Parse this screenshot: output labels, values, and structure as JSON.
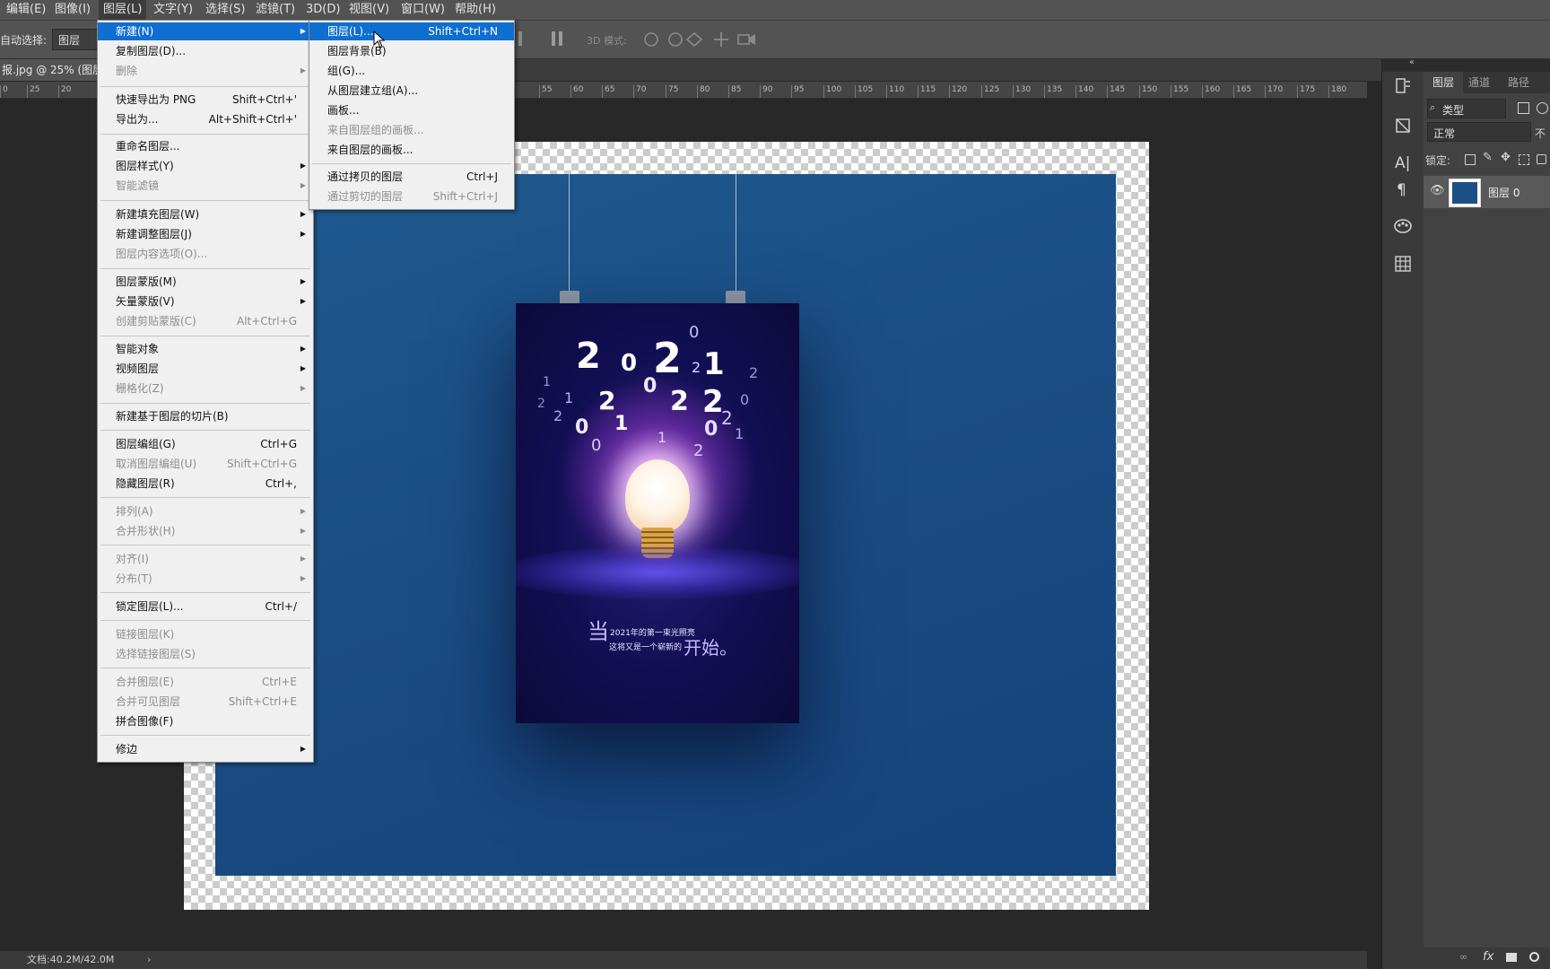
{
  "menubar": {
    "items": [
      "编辑(E)",
      "图像(I)",
      "图层(L)",
      "文字(Y)",
      "选择(S)",
      "滤镜(T)",
      "3D(D)",
      "视图(V)",
      "窗口(W)",
      "帮助(H)"
    ]
  },
  "options": {
    "auto_select_label": "自动选择:",
    "auto_select_value": "图层",
    "mode3d_label": "3D 模式:"
  },
  "doc": {
    "tab_title": "报.jpg @ 25% (图层",
    "status": "文档:40.2M/42.0M"
  },
  "ruler": {
    "ticks": [
      "0",
      "25",
      "20",
      "55",
      "60",
      "65",
      "70",
      "75",
      "80",
      "85",
      "90",
      "95",
      "100",
      "105",
      "110",
      "115",
      "120",
      "125",
      "130",
      "135",
      "140",
      "145",
      "150",
      "155",
      "160",
      "165",
      "170",
      "175",
      "180"
    ]
  },
  "layer_menu": {
    "items": [
      {
        "label": "新建(N)",
        "shortcut": "",
        "submenu": true,
        "disabled": false,
        "highlight": true
      },
      {
        "label": "复制图层(D)...",
        "shortcut": "",
        "submenu": false,
        "disabled": false
      },
      {
        "label": "删除",
        "shortcut": "",
        "submenu": true,
        "disabled": true
      },
      {
        "label": "快速导出为 PNG",
        "shortcut": "Shift+Ctrl+'",
        "submenu": false,
        "disabled": false
      },
      {
        "label": "导出为...",
        "shortcut": "Alt+Shift+Ctrl+'",
        "submenu": false,
        "disabled": false
      },
      {
        "label": "重命名图层...",
        "shortcut": "",
        "submenu": false,
        "disabled": false
      },
      {
        "label": "图层样式(Y)",
        "shortcut": "",
        "submenu": true,
        "disabled": false
      },
      {
        "label": "智能滤镜",
        "shortcut": "",
        "submenu": true,
        "disabled": true
      },
      {
        "label": "新建填充图层(W)",
        "shortcut": "",
        "submenu": true,
        "disabled": false
      },
      {
        "label": "新建调整图层(J)",
        "shortcut": "",
        "submenu": true,
        "disabled": false
      },
      {
        "label": "图层内容选项(O)...",
        "shortcut": "",
        "submenu": false,
        "disabled": true
      },
      {
        "label": "图层蒙版(M)",
        "shortcut": "",
        "submenu": true,
        "disabled": false
      },
      {
        "label": "矢量蒙版(V)",
        "shortcut": "",
        "submenu": true,
        "disabled": false
      },
      {
        "label": "创建剪贴蒙版(C)",
        "shortcut": "Alt+Ctrl+G",
        "submenu": false,
        "disabled": true
      },
      {
        "label": "智能对象",
        "shortcut": "",
        "submenu": true,
        "disabled": false
      },
      {
        "label": "视频图层",
        "shortcut": "",
        "submenu": true,
        "disabled": false
      },
      {
        "label": "栅格化(Z)",
        "shortcut": "",
        "submenu": true,
        "disabled": true
      },
      {
        "label": "新建基于图层的切片(B)",
        "shortcut": "",
        "submenu": false,
        "disabled": false
      },
      {
        "label": "图层编组(G)",
        "shortcut": "Ctrl+G",
        "submenu": false,
        "disabled": false
      },
      {
        "label": "取消图层编组(U)",
        "shortcut": "Shift+Ctrl+G",
        "submenu": false,
        "disabled": true
      },
      {
        "label": "隐藏图层(R)",
        "shortcut": "Ctrl+,",
        "submenu": false,
        "disabled": false
      },
      {
        "label": "排列(A)",
        "shortcut": "",
        "submenu": true,
        "disabled": true
      },
      {
        "label": "合并形状(H)",
        "shortcut": "",
        "submenu": true,
        "disabled": true
      },
      {
        "label": "对齐(I)",
        "shortcut": "",
        "submenu": true,
        "disabled": true
      },
      {
        "label": "分布(T)",
        "shortcut": "",
        "submenu": true,
        "disabled": true
      },
      {
        "label": "锁定图层(L)...",
        "shortcut": "Ctrl+/",
        "submenu": false,
        "disabled": false
      },
      {
        "label": "链接图层(K)",
        "shortcut": "",
        "submenu": false,
        "disabled": true
      },
      {
        "label": "选择链接图层(S)",
        "shortcut": "",
        "submenu": false,
        "disabled": true
      },
      {
        "label": "合并图层(E)",
        "shortcut": "Ctrl+E",
        "submenu": false,
        "disabled": true
      },
      {
        "label": "合并可见图层",
        "shortcut": "Shift+Ctrl+E",
        "submenu": false,
        "disabled": true
      },
      {
        "label": "拼合图像(F)",
        "shortcut": "",
        "submenu": false,
        "disabled": false
      },
      {
        "label": "修边",
        "shortcut": "",
        "submenu": true,
        "disabled": false
      }
    ]
  },
  "new_submenu": {
    "items": [
      {
        "label": "图层(L)...",
        "shortcut": "Shift+Ctrl+N",
        "disabled": false,
        "highlight": true
      },
      {
        "label": "图层背景(B)",
        "shortcut": "",
        "disabled": false
      },
      {
        "label": "组(G)...",
        "shortcut": "",
        "disabled": false
      },
      {
        "label": "从图层建立组(A)...",
        "shortcut": "",
        "disabled": false
      },
      {
        "label": "画板...",
        "shortcut": "",
        "disabled": false
      },
      {
        "label": "来自图层组的画板...",
        "shortcut": "",
        "disabled": true
      },
      {
        "label": "来自图层的画板...",
        "shortcut": "",
        "disabled": false
      },
      {
        "label": "通过拷贝的图层",
        "shortcut": "Ctrl+J",
        "disabled": false
      },
      {
        "label": "通过剪切的图层",
        "shortcut": "Shift+Ctrl+J",
        "disabled": true
      }
    ]
  },
  "poster": {
    "big_char": "当",
    "line1": "2021年的第一束光照亮",
    "line2": "这将又是一个崭新的",
    "big_end": "开始。",
    "digits": [
      "2",
      "0",
      "2",
      "1",
      "2",
      "0",
      "2",
      "1",
      "2",
      "0",
      "2",
      "1",
      "0",
      "2",
      "1",
      "2",
      "0",
      "2",
      "1",
      "0",
      "2",
      "0",
      "2",
      "1"
    ]
  },
  "layers_panel": {
    "tabs": [
      "图层",
      "通道",
      "路径"
    ],
    "filter": "类型",
    "blend": "正常",
    "opacity_cut": "不",
    "lock_label": "锁定:",
    "layer_name": "图层 0"
  },
  "colors": {
    "menu_highlight": "#0e6fd1",
    "ui_dark": "#535353",
    "poster_bg": "#120e52"
  }
}
